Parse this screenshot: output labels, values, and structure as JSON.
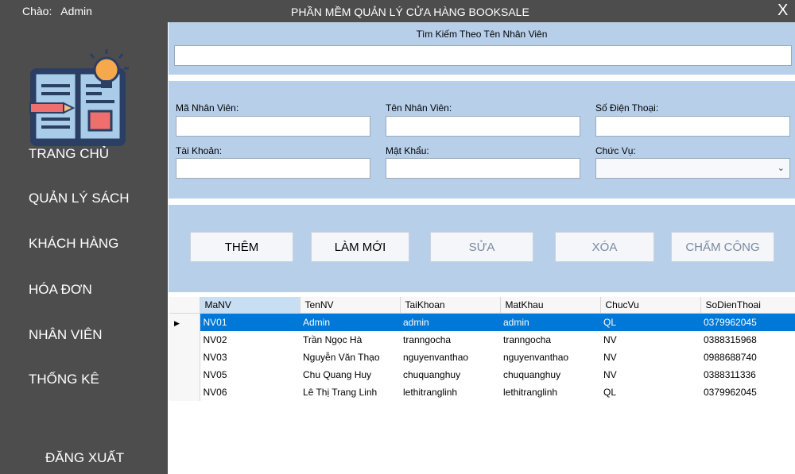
{
  "window": {
    "greeting": "Chào:",
    "user": "Admin",
    "title": "PHẦN MỀM QUẢN LÝ CỬA HÀNG BOOKSALE",
    "close": "X"
  },
  "sidebar": {
    "items": [
      {
        "label": "TRANG CHỦ"
      },
      {
        "label": "QUẢN LÝ SÁCH"
      },
      {
        "label": "KHÁCH HÀNG"
      },
      {
        "label": "HÓA ĐƠN"
      },
      {
        "label": "NHÂN VIÊN"
      },
      {
        "label": "THỐNG KÊ"
      }
    ],
    "logout": "ĐĂNG  XUẤT"
  },
  "search": {
    "label": "Tìm Kiếm Theo Tên Nhân Viên",
    "value": ""
  },
  "form": {
    "ma_nv_label": "Mã Nhân Viên:",
    "ten_nv_label": "Tên Nhân Viên:",
    "sdt_label": "Số Điện Thoại:",
    "tai_khoan_label": "Tài Khoản:",
    "mat_khau_label": "Mật Khẩu:",
    "chuc_vu_label": "Chức Vụ:"
  },
  "buttons": {
    "add": "THÊM",
    "refresh": "LÀM MỚI",
    "edit": "SỬA",
    "delete": "XÓA",
    "attendance": "CHẤM CÔNG"
  },
  "grid": {
    "columns": [
      "MaNV",
      "TenNV",
      "TaiKhoan",
      "MatKhau",
      "ChucVu",
      "SoDienThoai"
    ],
    "rows": [
      [
        "NV01",
        "Admin",
        "admin",
        "admin",
        "QL",
        "0379962045"
      ],
      [
        "NV02",
        "Trần Ngọc Hà",
        "tranngocha",
        "tranngocha",
        "NV",
        "0388315968"
      ],
      [
        "NV03",
        "Nguyễn Văn Thạo",
        "nguyenvanthao",
        "nguyenvanthao",
        "NV",
        "0988688740"
      ],
      [
        "NV05",
        "Chu Quang Huy",
        "chuquanghuy",
        "chuquanghuy",
        "NV",
        "0388311336"
      ],
      [
        "NV06",
        "Lê Thị Trang Linh",
        "lethitranglinh",
        "lethitranglinh",
        "QL",
        "0379962045"
      ]
    ]
  },
  "colors": {
    "sidebar": "#4d4d4d",
    "panel": "#b8cfea",
    "selection": "#0078d7"
  }
}
